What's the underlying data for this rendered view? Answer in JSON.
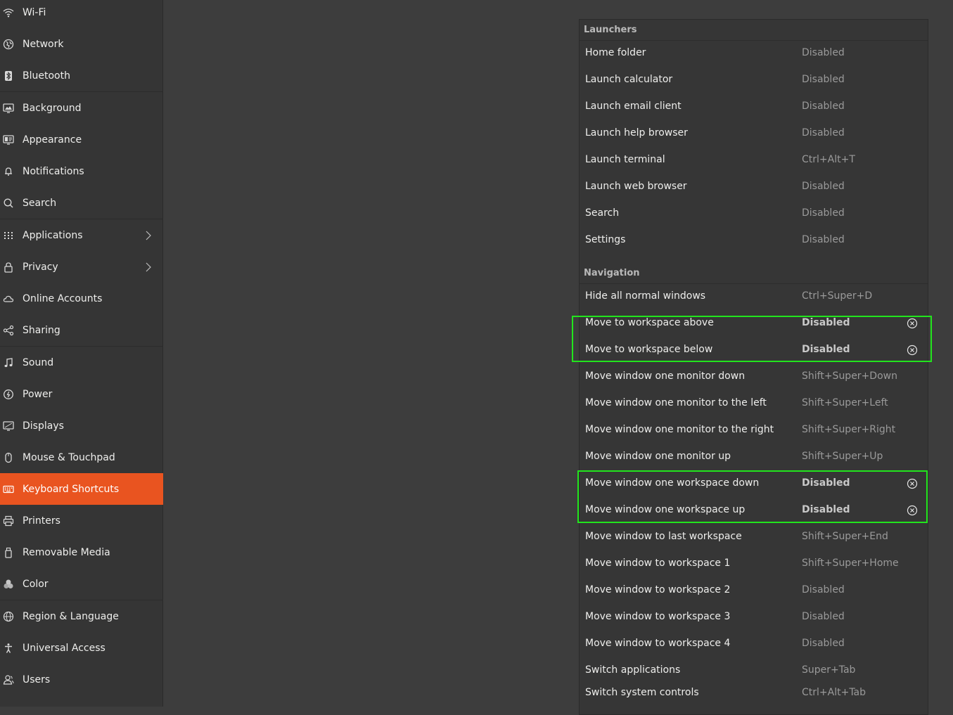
{
  "sidebar": {
    "items": [
      {
        "label": "Wi-Fi",
        "icon": "wifi-icon"
      },
      {
        "label": "Network",
        "icon": "network-icon"
      },
      {
        "label": "Bluetooth",
        "icon": "bluetooth-icon"
      },
      {
        "label": "Background",
        "icon": "background-icon"
      },
      {
        "label": "Appearance",
        "icon": "appearance-icon"
      },
      {
        "label": "Notifications",
        "icon": "bell-icon"
      },
      {
        "label": "Search",
        "icon": "search-icon"
      },
      {
        "label": "Applications",
        "icon": "grid-icon"
      },
      {
        "label": "Privacy",
        "icon": "lock-icon"
      },
      {
        "label": "Online Accounts",
        "icon": "cloud-icon"
      },
      {
        "label": "Sharing",
        "icon": "share-icon"
      },
      {
        "label": "Sound",
        "icon": "music-note-icon"
      },
      {
        "label": "Power",
        "icon": "power-icon"
      },
      {
        "label": "Displays",
        "icon": "display-icon"
      },
      {
        "label": "Mouse & Touchpad",
        "icon": "mouse-icon"
      },
      {
        "label": "Keyboard Shortcuts",
        "icon": "keyboard-icon"
      },
      {
        "label": "Printers",
        "icon": "printer-icon"
      },
      {
        "label": "Removable Media",
        "icon": "usb-icon"
      },
      {
        "label": "Color",
        "icon": "color-icon"
      },
      {
        "label": "Region & Language",
        "icon": "globe-icon"
      },
      {
        "label": "Universal Access",
        "icon": "accessibility-icon"
      },
      {
        "label": "Users",
        "icon": "users-icon"
      }
    ],
    "active_item": "Keyboard Shortcuts"
  },
  "shortcuts": {
    "launchers": {
      "header": "Launchers",
      "rows": [
        {
          "name": "Home folder",
          "accel": "Disabled"
        },
        {
          "name": "Launch calculator",
          "accel": "Disabled"
        },
        {
          "name": "Launch email client",
          "accel": "Disabled"
        },
        {
          "name": "Launch help browser",
          "accel": "Disabled"
        },
        {
          "name": "Launch terminal",
          "accel": "Ctrl+Alt+T"
        },
        {
          "name": "Launch web browser",
          "accel": "Disabled"
        },
        {
          "name": "Search",
          "accel": "Disabled"
        },
        {
          "name": "Settings",
          "accel": "Disabled"
        }
      ]
    },
    "navigation": {
      "header": "Navigation",
      "rows": [
        {
          "name": "Hide all normal windows",
          "accel": "Ctrl+Super+D"
        },
        {
          "name": "Move to workspace above",
          "accel": "Disabled"
        },
        {
          "name": "Move to workspace below",
          "accel": "Disabled"
        },
        {
          "name": "Move window one monitor down",
          "accel": "Shift+Super+Down"
        },
        {
          "name": "Move window one monitor to the left",
          "accel": "Shift+Super+Left"
        },
        {
          "name": "Move window one monitor to the right",
          "accel": "Shift+Super+Right"
        },
        {
          "name": "Move window one monitor up",
          "accel": "Shift+Super+Up"
        },
        {
          "name": "Move window one workspace down",
          "accel": "Disabled"
        },
        {
          "name": "Move window one workspace up",
          "accel": "Disabled"
        },
        {
          "name": "Move window to last workspace",
          "accel": "Shift+Super+End"
        },
        {
          "name": "Move window to workspace 1",
          "accel": "Shift+Super+Home"
        },
        {
          "name": "Move window to workspace 2",
          "accel": "Disabled"
        },
        {
          "name": "Move window to workspace 3",
          "accel": "Disabled"
        },
        {
          "name": "Move window to workspace 4",
          "accel": "Disabled"
        },
        {
          "name": "Switch applications",
          "accel": "Super+Tab"
        },
        {
          "name": "Switch system controls",
          "accel": "Ctrl+Alt+Tab"
        }
      ]
    }
  },
  "colors": {
    "accent": "#e95420",
    "highlight": "#22e51d"
  }
}
